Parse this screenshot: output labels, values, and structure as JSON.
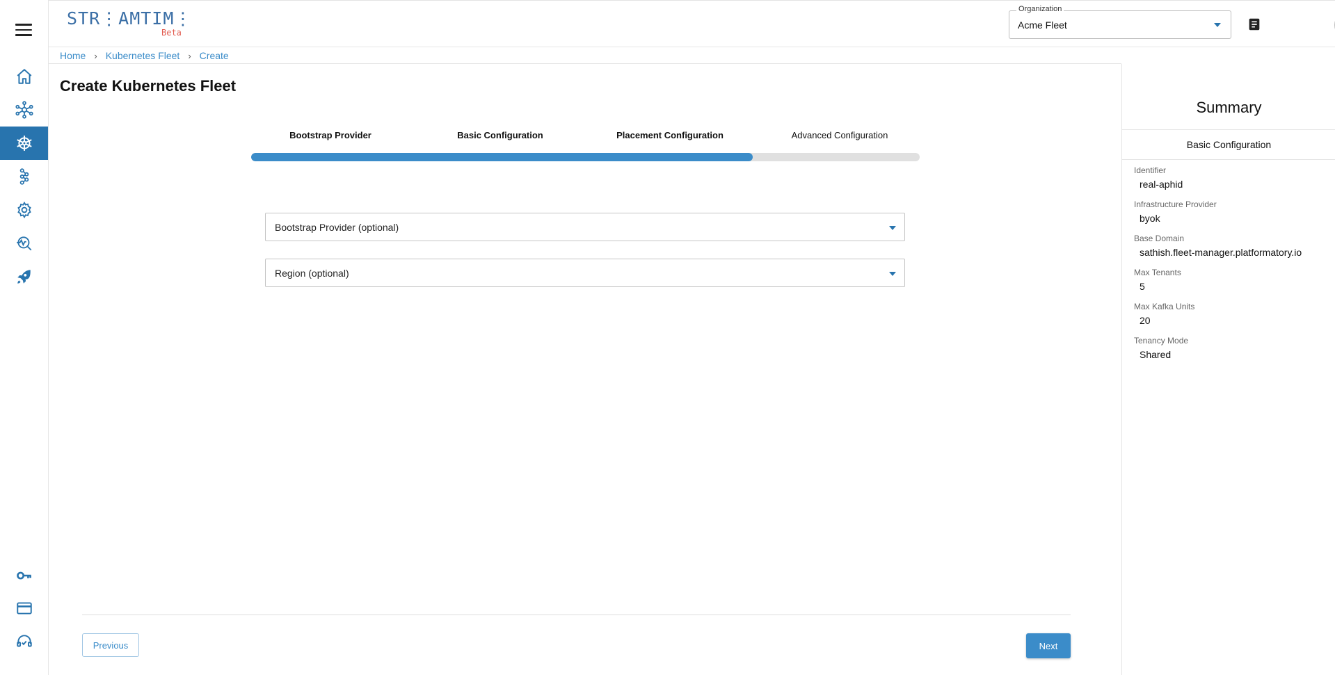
{
  "header": {
    "logo_text": "STR⋮AMTIM⋮",
    "logo_badge": "Beta",
    "organization_label": "Organization",
    "organization_value": "Acme Fleet"
  },
  "sidebar": {
    "items": [
      {
        "name": "home-icon"
      },
      {
        "name": "network-icon"
      },
      {
        "name": "kubernetes-helm-icon",
        "active": true
      },
      {
        "name": "cluster-icon"
      },
      {
        "name": "settings-gear-icon"
      },
      {
        "name": "monitoring-search-icon"
      },
      {
        "name": "rocket-icon"
      },
      {
        "name": "key-icon"
      },
      {
        "name": "credit-card-icon"
      },
      {
        "name": "support-headset-icon"
      }
    ]
  },
  "breadcrumb": [
    "Home",
    "Kubernetes Fleet",
    "Create"
  ],
  "page": {
    "title": "Create Kubernetes Fleet"
  },
  "stepper": {
    "steps": [
      "Bootstrap Provider",
      "Basic Configuration",
      "Placement Configuration",
      "Advanced Configuration"
    ],
    "progress_percent": 75
  },
  "form": {
    "bootstrap_provider_placeholder": "Bootstrap Provider (optional)",
    "region_placeholder": "Region (optional)"
  },
  "buttons": {
    "previous": "Previous",
    "next": "Next"
  },
  "summary": {
    "title": "Summary",
    "section": "Basic Configuration",
    "fields": [
      {
        "label": "Identifier",
        "value": "real-aphid"
      },
      {
        "label": "Infrastructure Provider",
        "value": "byok"
      },
      {
        "label": "Base Domain",
        "value": "sathish.fleet-manager.platformatory.io"
      },
      {
        "label": "Max Tenants",
        "value": "5"
      },
      {
        "label": "Max Kafka Units",
        "value": "20"
      },
      {
        "label": "Tenancy Mode",
        "value": "Shared"
      }
    ]
  },
  "colors": {
    "accent": "#3b8cc9",
    "sidebar_active": "#2874ae",
    "logo": "#3b6fa6",
    "logo_badge": "#e25b4f"
  }
}
